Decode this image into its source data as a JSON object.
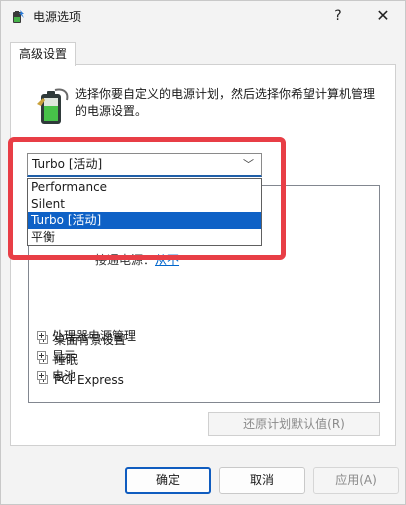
{
  "window": {
    "title": "电源选项",
    "help_label": "?",
    "close_label": "✕",
    "icon": "power-options-icon"
  },
  "tab": {
    "label": "高级设置"
  },
  "description": "选择你要自定义的电源计划，然后选择你希望计算机管理的电源设置。",
  "plan_select": {
    "value": "Turbo [活动]",
    "options": [
      "Performance",
      "Silent",
      "Turbo [活动]",
      "平衡"
    ],
    "selected_index": 2
  },
  "tree": {
    "partial_line": "接通电源：",
    "partial_link": "从不",
    "items": [
      "桌面背景设置",
      "睡眠",
      "PCI Express",
      "处理器电源管理",
      "显示",
      "电池"
    ]
  },
  "buttons": {
    "restore": "还原计划默认值(R)",
    "ok": "确定",
    "cancel": "取消",
    "apply": "应用(A)"
  },
  "colors": {
    "highlight": "#e83e46",
    "selection": "#0e61c6",
    "accent": "#0f5cbf"
  }
}
